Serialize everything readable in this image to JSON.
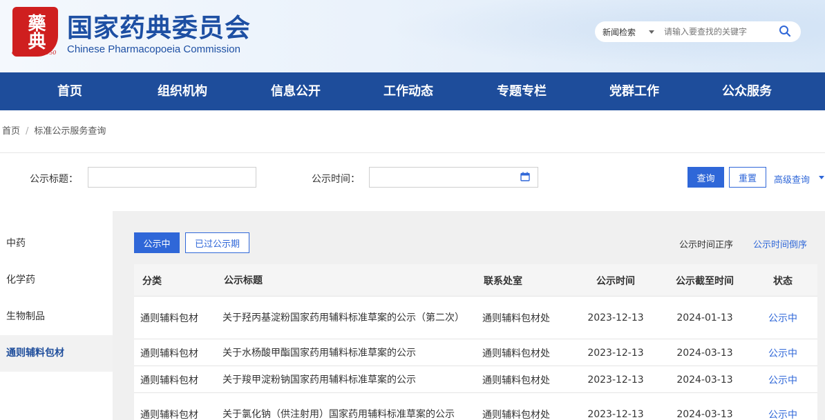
{
  "header": {
    "seal_glyph": "藥典",
    "since": "ChP Since 1950",
    "title": "国家药典委员会",
    "subtitle": "Chinese Pharmacopoeia Commission",
    "search_scope": "新闻检索",
    "search_placeholder": "请输入要查找的关键字"
  },
  "nav": [
    "首页",
    "组织机构",
    "信息公开",
    "工作动态",
    "专题专栏",
    "党群工作",
    "公众服务"
  ],
  "breadcrumb": {
    "home": "首页",
    "sep": "/",
    "current": "标准公示服务查询"
  },
  "filter": {
    "title_label": "公示标题：",
    "time_label": "公示时间：",
    "query": "查询",
    "reset": "重置",
    "advanced": "高级查询"
  },
  "sidebar": [
    "中药",
    "化学药",
    "生物制品",
    "通则辅料包材"
  ],
  "sidebar_active": 3,
  "tabs": {
    "active": "公示中",
    "expired": "已过公示期"
  },
  "sort": {
    "asc": "公示时间正序",
    "desc": "公示时间倒序"
  },
  "table": {
    "headers": [
      "分类",
      "公示标题",
      "联系处室",
      "公示时间",
      "公示截至时间",
      "状态"
    ],
    "rows": [
      [
        "通则辅料包材",
        "关于羟丙基淀粉国家药用辅料标准草案的公示（第二次）",
        "通则辅料包材处",
        "2023-12-13",
        "2024-01-13",
        "公示中"
      ],
      [
        "通则辅料包材",
        "关于水杨酸甲酯国家药用辅料标准草案的公示",
        "通则辅料包材处",
        "2023-12-13",
        "2024-03-13",
        "公示中"
      ],
      [
        "通则辅料包材",
        "关于羧甲淀粉钠国家药用辅料标准草案的公示",
        "通则辅料包材处",
        "2023-12-13",
        "2024-03-13",
        "公示中"
      ],
      [
        "通则辅料包材",
        "关于氯化钠（供注射用）国家药用辅料标准草案的公示",
        "通则辅料包材处",
        "2023-12-13",
        "2024-03-13",
        "公示中"
      ]
    ]
  },
  "colors": {
    "brand_blue": "#1e4d9b",
    "accent_blue": "#2f67d8",
    "seal_red": "#cf1f1f"
  }
}
